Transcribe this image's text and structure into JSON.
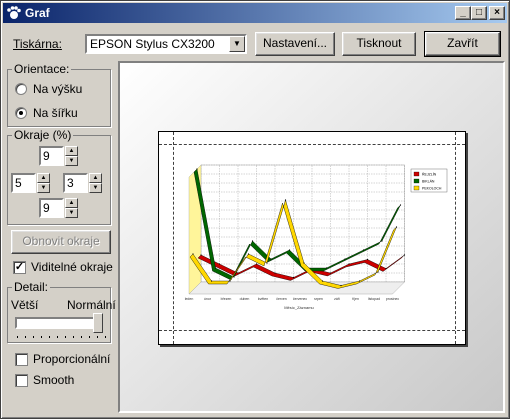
{
  "window": {
    "title": "Graf",
    "controls": {
      "minimize": "_",
      "maximize": "□",
      "close": "×"
    }
  },
  "toolbar": {
    "printer_label": "Tiskárna:",
    "printer_value": "EPSON Stylus CX3200",
    "settings_label": "Nastavení...",
    "print_label": "Tisknout",
    "close_label": "Zavřít"
  },
  "orientation": {
    "legend": "Orientace:",
    "portrait_label": "Na výšku",
    "landscape_label": "Na šířku",
    "selected": "landscape"
  },
  "margins": {
    "legend": "Okraje (%)",
    "top": "9",
    "left": "5",
    "right": "3",
    "bottom": "9",
    "reset_label": "Obnovit okraje",
    "visible_label": "Viditelné okraje",
    "visible_checked": true
  },
  "detail": {
    "legend": "Detail:",
    "more_label": "Větší",
    "normal_label": "Normální",
    "level": 1.0
  },
  "options": {
    "proportional_label": "Proporcionální",
    "proportional_checked": false,
    "smooth_label": "Smooth",
    "smooth_checked": false
  },
  "chart_data": {
    "type": "line",
    "categories": [
      "leden",
      "únor",
      "březen",
      "duben",
      "květen",
      "červen",
      "červenec",
      "srpen",
      "září",
      "říjen",
      "listopad",
      "prosinec"
    ],
    "series": [
      {
        "name": "ŘEJZLÍN",
        "color": "#cc0000",
        "values": [
          3,
          2,
          1,
          2,
          1,
          0.5,
          1.5,
          1,
          2,
          2.5,
          1.5,
          3
        ]
      },
      {
        "name": "BIKLÁN",
        "color": "#006600",
        "values": [
          13,
          2,
          1,
          5,
          3,
          4,
          2,
          2,
          3,
          4,
          5,
          9
        ]
      },
      {
        "name": "PEKOLOCH",
        "color": "#ffd700",
        "values": [
          4,
          1,
          1,
          4,
          3,
          10,
          3,
          1,
          0.5,
          1,
          2,
          7
        ]
      }
    ],
    "xlabel": "Měsíc_Záznamu"
  }
}
